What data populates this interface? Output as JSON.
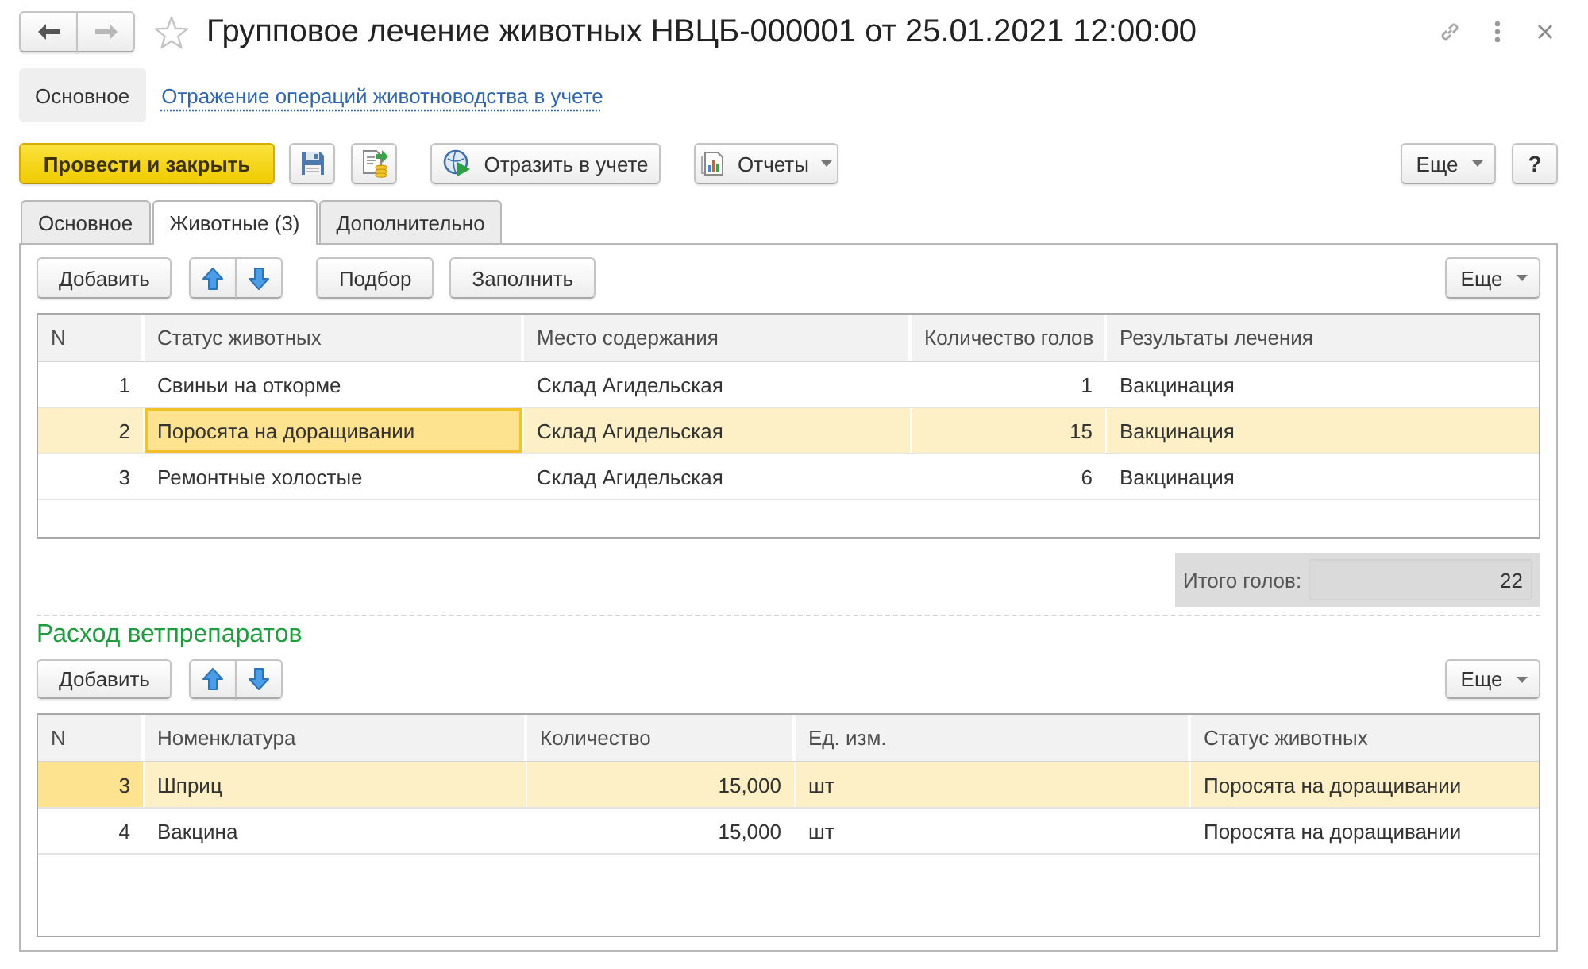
{
  "window": {
    "title": "Групповое лечение животных НВЦБ-000001 от 25.01.2021 12:00:00",
    "favorite": false
  },
  "navigation": [
    {
      "kind": "back",
      "disabled": false
    },
    {
      "kind": "forward",
      "disabled": true
    }
  ],
  "sections": [
    {
      "label": "Основное",
      "selected": true
    },
    {
      "label": "Отражение операций животноводства в учете",
      "selected": false
    }
  ],
  "command_bar": {
    "primary": "Провести и закрыть",
    "actions": [
      {
        "label": "Отразить в учете",
        "kind": "button"
      },
      {
        "label": "Отчеты",
        "kind": "menu"
      }
    ],
    "more": "Еще",
    "help": "?"
  },
  "tabs": [
    {
      "label": "Основное",
      "selected": false
    },
    {
      "label": "Животные (3)",
      "selected": true
    },
    {
      "label": "Дополнительно",
      "selected": false
    }
  ],
  "animals": {
    "toolbar": {
      "buttons": [
        "Добавить",
        "Подбор",
        "Заполнить"
      ],
      "more": "Еще"
    },
    "table": {
      "focused": true,
      "columns": [
        {
          "title": "N",
          "kind": "number"
        },
        {
          "title": "Статус животных",
          "kind": "text"
        },
        {
          "title": "Место содержания",
          "kind": "text"
        },
        {
          "title": "Количество голов",
          "kind": "number"
        },
        {
          "title": "Результаты лечения",
          "kind": "text"
        }
      ],
      "rows": [
        {
          "selected": false,
          "cells": [
            {
              "text": "1",
              "current": false
            },
            {
              "text": "Свиньи на откорме",
              "current": false
            },
            {
              "text": "Склад Агидельская",
              "current": false
            },
            {
              "text": "1",
              "current": false
            },
            {
              "text": "Вакцинация",
              "current": false
            }
          ]
        },
        {
          "selected": true,
          "cells": [
            {
              "text": "2",
              "current": false
            },
            {
              "text": "Поросята на доращивании",
              "current": true
            },
            {
              "text": "Склад Агидельская",
              "current": false
            },
            {
              "text": "15",
              "current": false
            },
            {
              "text": "Вакцинация",
              "current": false
            }
          ]
        },
        {
          "selected": false,
          "cells": [
            {
              "text": "3",
              "current": false
            },
            {
              "text": "Ремонтные холостые",
              "current": false
            },
            {
              "text": "Склад Агидельская",
              "current": false
            },
            {
              "text": "6",
              "current": false
            },
            {
              "text": "Вакцинация",
              "current": false
            }
          ]
        }
      ]
    },
    "total": {
      "label": "Итого голов:",
      "value": "22"
    }
  },
  "drugs": {
    "title": "Расход ветпрепаратов",
    "toolbar": {
      "buttons": [
        "Добавить"
      ],
      "more": "Еще"
    },
    "table": {
      "focused": false,
      "columns": [
        {
          "title": "N",
          "kind": "number"
        },
        {
          "title": "Номенклатура",
          "kind": "text"
        },
        {
          "title": "Количество",
          "kind": "number"
        },
        {
          "title": "Ед. изм.",
          "kind": "text"
        },
        {
          "title": "Статус животных",
          "kind": "text"
        }
      ],
      "rows": [
        {
          "selected": true,
          "cells": [
            {
              "text": "3",
              "current": true
            },
            {
              "text": "Шприц",
              "current": false
            },
            {
              "text": "15,000",
              "current": false
            },
            {
              "text": "шт",
              "current": false
            },
            {
              "text": "Поросята на доращивании",
              "current": false
            }
          ]
        },
        {
          "selected": false,
          "cells": [
            {
              "text": "4",
              "current": false
            },
            {
              "text": "Вакцина",
              "current": false
            },
            {
              "text": "15,000",
              "current": false
            },
            {
              "text": "шт",
              "current": false
            },
            {
              "text": "Поросята на доращивании",
              "current": false
            }
          ]
        }
      ]
    }
  }
}
